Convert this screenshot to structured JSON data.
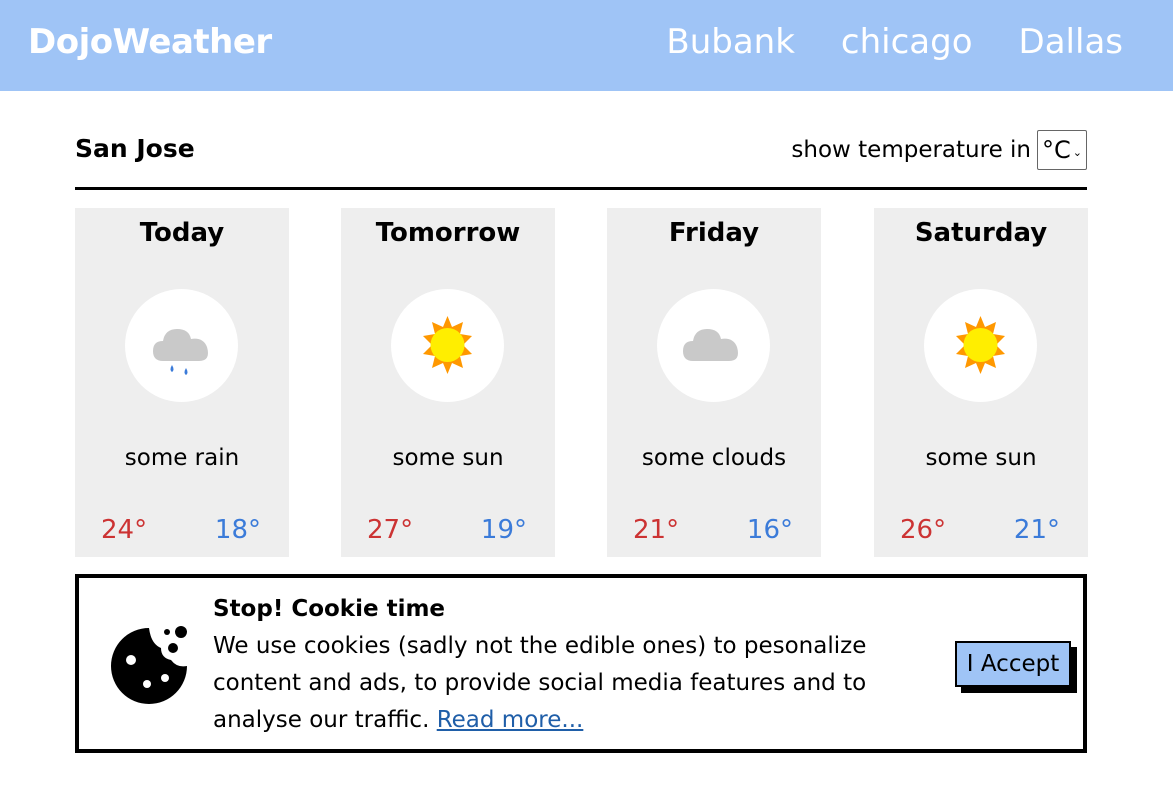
{
  "header": {
    "brand": "DojoWeather",
    "nav": [
      "Bubank",
      "chicago",
      "Dallas"
    ]
  },
  "location": {
    "city": "San Jose",
    "unit_label": "show temperature in",
    "unit_value": "°C"
  },
  "forecast": [
    {
      "day": "Today",
      "icon": "rain-cloud-icon",
      "description": "some rain",
      "high": "24°",
      "low": "18°"
    },
    {
      "day": "Tomorrow",
      "icon": "sun-icon",
      "description": "some sun",
      "high": "27°",
      "low": "19°"
    },
    {
      "day": "Friday",
      "icon": "cloud-icon",
      "description": "some clouds",
      "high": "21°",
      "low": "16°"
    },
    {
      "day": "Saturday",
      "icon": "sun-icon",
      "description": "some sun",
      "high": "26°",
      "low": "21°"
    }
  ],
  "cookie": {
    "title": "Stop! Cookie time",
    "text": "We use cookies (sadly not the edible ones) to pesonalize content and ads, to provide social media features and to analyse our traffic. ",
    "link": "Read more...",
    "accept": "I Accept"
  },
  "colors": {
    "header_bg": "#9fc4f6",
    "high_temp": "#cc3333",
    "low_temp": "#3b7bd9",
    "card_bg": "#eeeeee"
  }
}
